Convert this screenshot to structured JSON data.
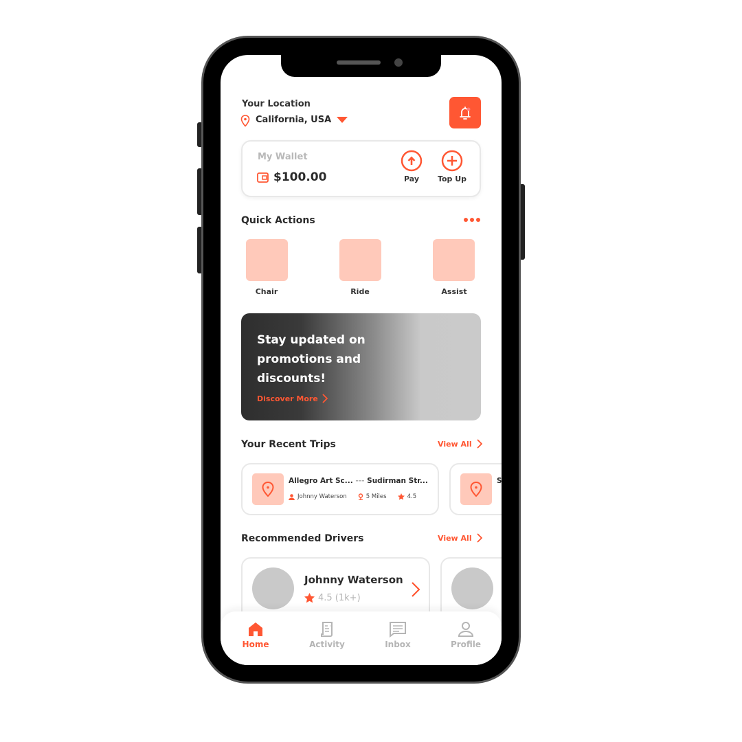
{
  "header": {
    "location_label": "Your Location",
    "location_value": "California, USA"
  },
  "wallet": {
    "title": "My Wallet",
    "balance": "$100.00",
    "pay_label": "Pay",
    "topup_label": "Top Up"
  },
  "quick_actions": {
    "title": "Quick Actions",
    "items": [
      {
        "label": "Chair"
      },
      {
        "label": "Ride"
      },
      {
        "label": "Assist"
      }
    ]
  },
  "promo": {
    "title": "Stay updated on promotions and discounts!",
    "cta": "Discover More"
  },
  "recent_trips": {
    "title": "Your Recent Trips",
    "view_all": "View All",
    "items": [
      {
        "from": "Allegro Art Sc...",
        "to": "Sudirman Str...",
        "driver": "Johnny Waterson",
        "distance": "5 Miles",
        "rating": "4.5"
      },
      {
        "from": "S"
      }
    ]
  },
  "drivers": {
    "title": "Recommended Drivers",
    "view_all": "View All",
    "items": [
      {
        "name": "Johnny Waterson",
        "rating": "4.5 (1k+)"
      }
    ]
  },
  "nav": {
    "items": [
      {
        "label": "Home",
        "icon": "home-icon",
        "active": true
      },
      {
        "label": "Activity",
        "icon": "receipt-icon"
      },
      {
        "label": "Inbox",
        "icon": "message-icon"
      },
      {
        "label": "Profile",
        "icon": "user-icon"
      }
    ]
  },
  "colors": {
    "accent": "#FF5733",
    "accent_light": "#FFC9BA"
  }
}
